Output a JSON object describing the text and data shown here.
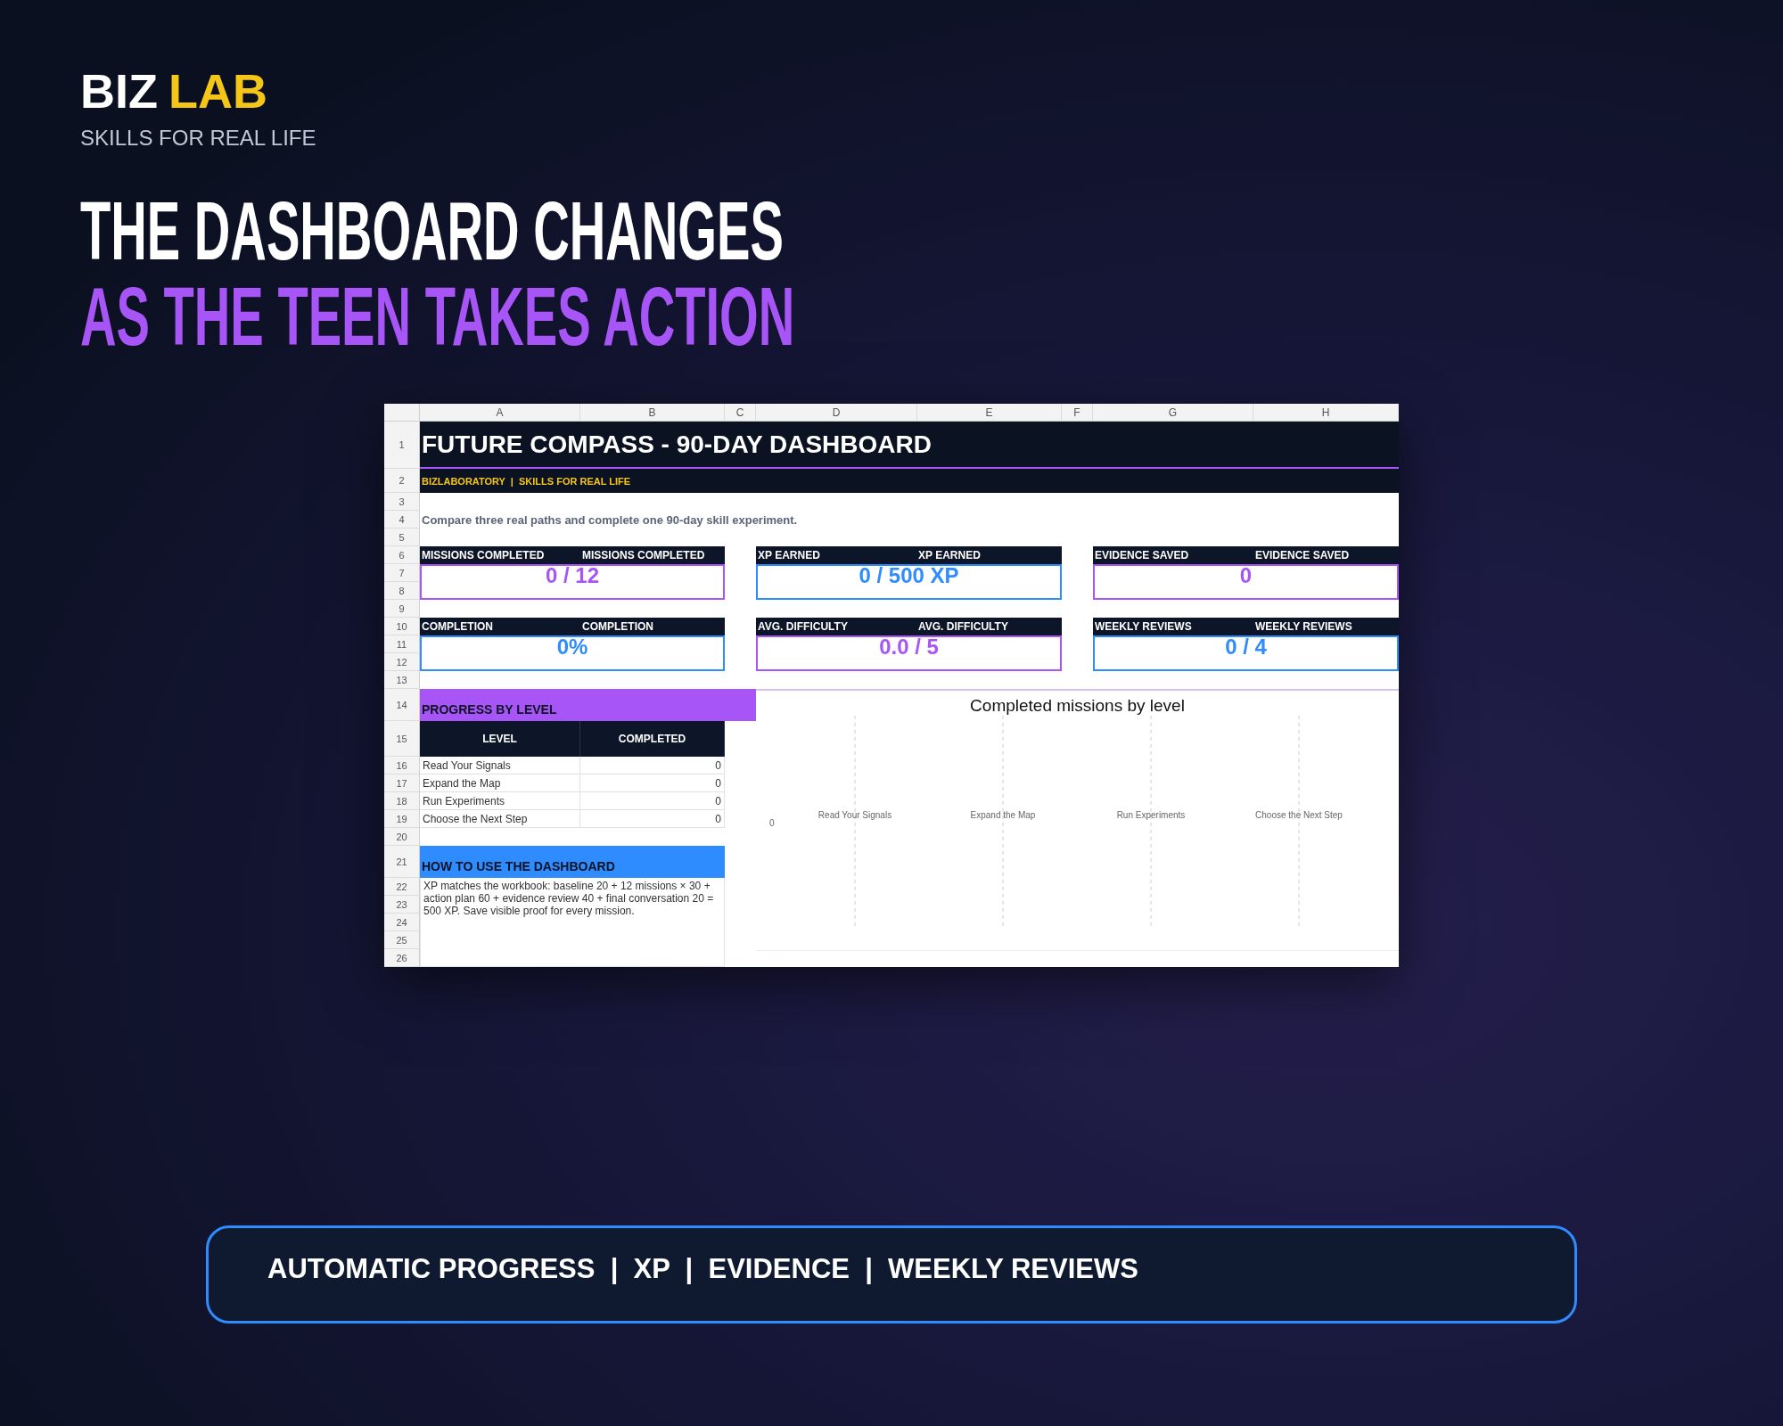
{
  "brand": {
    "name_part_1": "BIZ",
    "name_part_2": "LAB",
    "tagline": "SKILLS FOR REAL LIFE"
  },
  "headline": {
    "line_1": "THE DASHBOARD CHANGES",
    "line_2": "AS THE TEEN TAKES ACTION"
  },
  "sheet": {
    "column_headers": [
      "A",
      "B",
      "C",
      "D",
      "E",
      "F",
      "G",
      "H"
    ],
    "row_numbers": [
      "1",
      "2",
      "3",
      "4",
      "5",
      "6",
      "7",
      "8",
      "9",
      "10",
      "11",
      "12",
      "13",
      "14",
      "15",
      "16",
      "17",
      "18",
      "19",
      "20",
      "21",
      "22",
      "23",
      "24",
      "25",
      "26"
    ],
    "title": "FUTURE COMPASS - 90-DAY DASHBOARD",
    "subtitle": "BIZLABORATORY  |  SKILLS FOR REAL LIFE",
    "intro": "Compare three real paths and complete one 90-day skill experiment.",
    "cards": [
      {
        "label_1": "MISSIONS COMPLETED",
        "label_2": "MISSIONS COMPLETED",
        "value": "0 / 12",
        "color": "#a855f7"
      },
      {
        "label_1": "XP EARNED",
        "label_2": "XP EARNED",
        "value": "0 / 500 XP",
        "color": "#2f8cff"
      },
      {
        "label_1": "EVIDENCE SAVED",
        "label_2": "EVIDENCE SAVED",
        "value": "0",
        "color": "#a855f7"
      },
      {
        "label_1": "COMPLETION",
        "label_2": "COMPLETION",
        "value": "0%",
        "color": "#2f8cff"
      },
      {
        "label_1": "AVG. DIFFICULTY",
        "label_2": "AVG. DIFFICULTY",
        "value": "0.0 / 5",
        "color": "#a855f7"
      },
      {
        "label_1": "WEEKLY REVIEWS",
        "label_2": "WEEKLY REVIEWS",
        "value": "0 / 4",
        "color": "#2f8cff"
      }
    ],
    "progress_heading": "PROGRESS BY LEVEL",
    "table": {
      "columns": [
        "LEVEL",
        "COMPLETED"
      ],
      "rows": [
        {
          "level": "Read Your Signals",
          "completed": "0"
        },
        {
          "level": "Expand the Map",
          "completed": "0"
        },
        {
          "level": "Run Experiments",
          "completed": "0"
        },
        {
          "level": "Choose the Next Step",
          "completed": "0"
        }
      ]
    },
    "howto_heading": "HOW TO USE THE DASHBOARD",
    "howto_text": "XP matches the workbook: baseline 20 + 12 missions × 30 + action plan 60 + evidence review 40 + final conversation 20 = 500 XP. Save visible proof for every mission.",
    "chart": {
      "chart_data": {
        "type": "other",
        "title": "Completed missions by level",
        "categories": [
          "Read Your Signals",
          "Expand the Map",
          "Run Experiments",
          "Choose the Next Step"
        ]
      },
      "axis_value": "0"
    }
  },
  "banner": {
    "text": "AUTOMATIC PROGRESS  |  XP  |  EVIDENCE  |  WEEKLY REVIEWS"
  }
}
